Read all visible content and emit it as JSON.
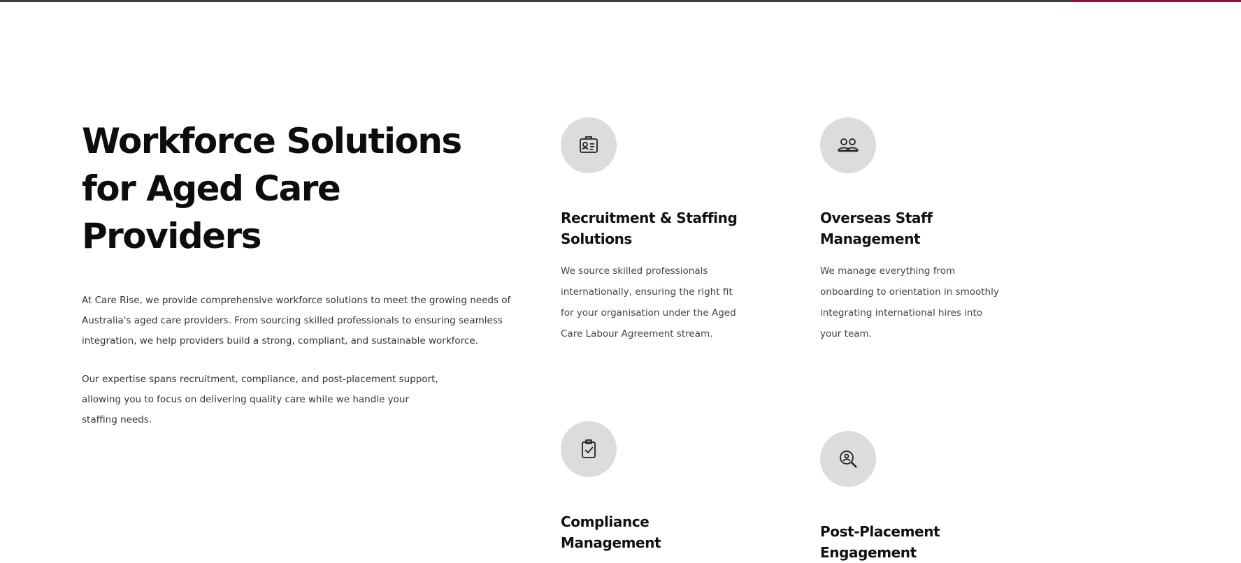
{
  "colors": {
    "top_bar": "#3f3f3f",
    "accent": "#8a1538",
    "icon_circle": "#dcdcdc",
    "heading": "#0d0d0d",
    "body_text": "#333333"
  },
  "intro": {
    "heading": "Workforce Solutions for Aged Care Providers",
    "paragraph_1": "At Care Rise, we provide comprehensive workforce solutions to meet the growing needs of Australia's aged care providers. From sourcing skilled professionals to ensuring seamless integration, we help providers build a strong, compliant, and sustainable workforce.",
    "paragraph_2": "Our expertise spans recruitment, compliance, and post-placement support, allowing you to focus on delivering quality care while we handle your staffing needs."
  },
  "services": [
    {
      "icon": "id-badge-icon",
      "title": "Recruitment & Staffing Solutions",
      "text": "We source skilled professionals internationally, ensuring the right fit for your organisation under the Aged Care Labour Agreement stream."
    },
    {
      "icon": "staff-group-icon",
      "title": "Overseas Staff Management",
      "text": "We manage everything from onboarding to orientation in smoothly integrating international hires into your team."
    },
    {
      "icon": "clipboard-check-icon",
      "title": "Compliance Management",
      "text": ""
    },
    {
      "icon": "magnifier-person-icon",
      "title": "Post-Placement Engagement",
      "text": ""
    }
  ]
}
